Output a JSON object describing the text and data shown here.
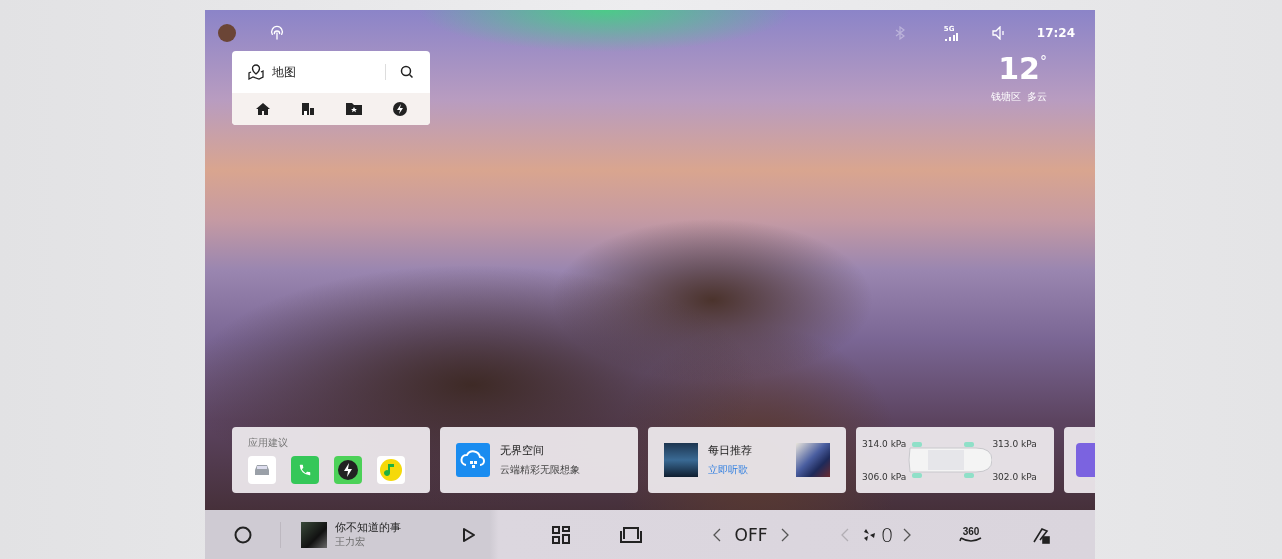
{
  "status_bar": {
    "network": "5G",
    "time": "17:24",
    "bluetooth_on": false
  },
  "map_widget": {
    "title": "地图",
    "shortcuts": [
      {
        "kind": "home"
      },
      {
        "kind": "company"
      },
      {
        "kind": "favorites"
      },
      {
        "kind": "charging"
      }
    ]
  },
  "weather": {
    "temperature": "12",
    "unit": "°",
    "district": "钱塘区",
    "condition": "多云"
  },
  "cards": [
    {
      "kind": "apps",
      "title": "应用建议",
      "apps": [
        {
          "kind": "car"
        },
        {
          "kind": "phone"
        },
        {
          "kind": "charge"
        },
        {
          "kind": "music"
        }
      ]
    },
    {
      "kind": "cloud",
      "title": "无界空间",
      "subtitle": "云端精彩无限想象"
    },
    {
      "kind": "music",
      "title": "每日推荐",
      "link": "立即听歌"
    },
    {
      "kind": "tires",
      "pressures": [
        "314.0 kPa",
        "313.0 kPa",
        "306.0 kPa",
        "302.0 kPa"
      ]
    },
    {
      "kind": "edge"
    }
  ],
  "dock": {
    "song": "你不知道的事",
    "artist": "王力宏",
    "ac": {
      "value": "OFF",
      "decrease_disabled": false,
      "increase_disabled": false
    },
    "fan": {
      "value": "0",
      "decrease_disabled": true,
      "increase_disabled": false
    },
    "view_label": "360"
  }
}
